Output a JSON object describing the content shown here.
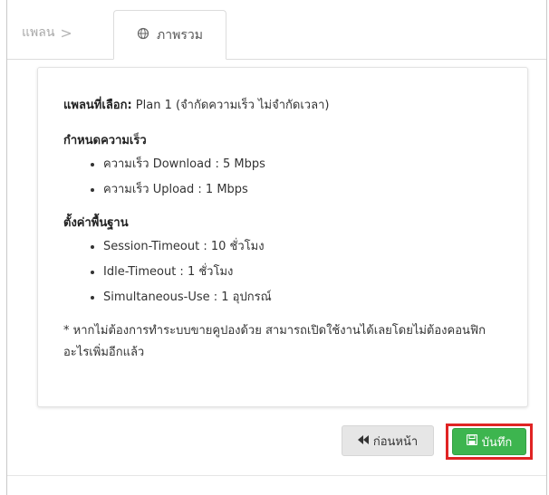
{
  "tabs": {
    "plan_label": "แพลน",
    "plan_chevron": ">",
    "overview_label": "ภาพรวม"
  },
  "summary": {
    "plan_label": "แพลนที่เลือก:",
    "plan_value": " Plan 1 (จำกัดความเร็ว ไม่จำกัดเวลา)",
    "speed_title": "กำหนดความเร็ว",
    "speed_items": [
      "ความเร็ว Download : 5 Mbps",
      "ความเร็ว Upload : 1 Mbps"
    ],
    "basic_title": "ตั้งค่าพื้นฐาน",
    "basic_items": [
      "Session-Timeout : 10 ชั่วโมง",
      "Idle-Timeout : 1 ชั่วโมง",
      "Simultaneous-Use : 1 อุปกรณ์"
    ],
    "note": "* หากไม่ต้องการทำระบบขายคูปองด้วย สามารถเปิดใช้งานได้เลยโดยไม่ต้องคอนฟิกอะไรเพิ่มอีกแล้ว"
  },
  "actions": {
    "back_icon": "◀◀",
    "back_label": "ก่อนหน้า",
    "save_icon": "🖫",
    "save_label": "บันทึก"
  },
  "colors": {
    "save_green": "#3db54f",
    "highlight_red": "#e02424",
    "back_gray": "#e6e6e6"
  }
}
